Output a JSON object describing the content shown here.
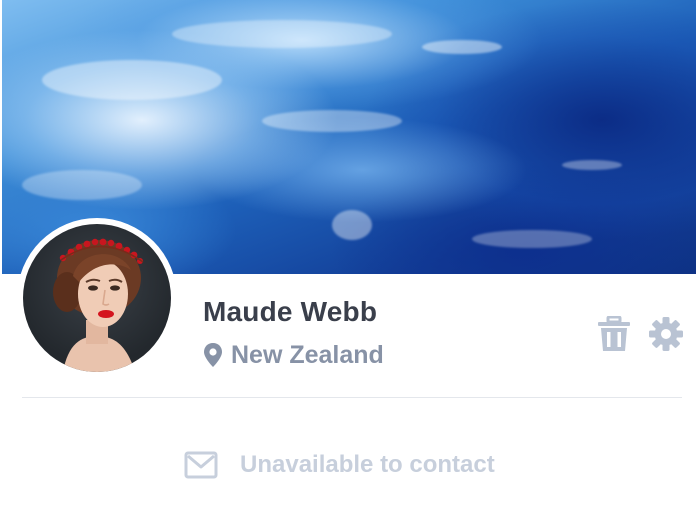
{
  "profile": {
    "name": "Maude Webb",
    "location": "New Zealand",
    "cover_image": "ocean-waves",
    "avatar_image": "woman-portrait-with-red-flower-crown"
  },
  "actions": {
    "delete_icon": "trash-icon",
    "settings_icon": "gear-icon"
  },
  "contact": {
    "label": "Unavailable to contact",
    "icon": "envelope-icon",
    "enabled": false
  },
  "colors": {
    "name_text": "#3a3f4b",
    "location_text": "#8792a6",
    "icon_muted": "#b9c3d3",
    "contact_disabled": "#c7cfdc",
    "divider": "#e4e7ec"
  }
}
